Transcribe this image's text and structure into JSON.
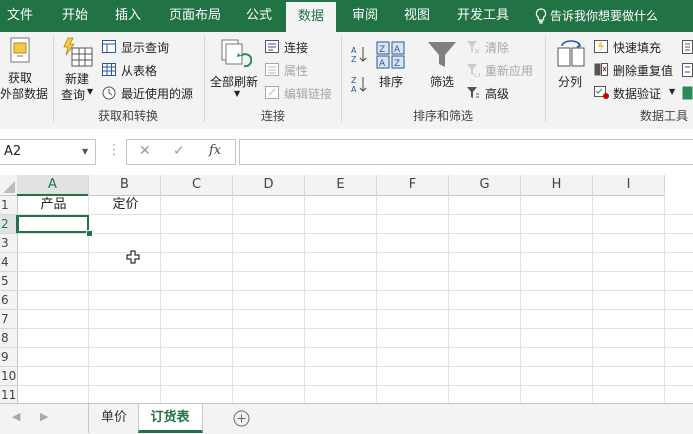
{
  "tabs": [
    "文件",
    "开始",
    "插入",
    "页面布局",
    "公式",
    "数据",
    "审阅",
    "视图",
    "开发工具"
  ],
  "tell_me": "告诉我你想要做什么",
  "ribbon": {
    "get_external": {
      "line1": "获取",
      "line2": "外部数据"
    },
    "new_query": {
      "line1": "新建",
      "line2": "查询"
    },
    "show_queries": "显示查询",
    "from_table": "从表格",
    "recent_sources": "最近使用的源",
    "group_get_transform": "获取和转换",
    "refresh_all": "全部刷新",
    "connections": "连接",
    "properties": "属性",
    "edit_links": "编辑链接",
    "group_connections": "连接",
    "sort": "排序",
    "filter": "筛选",
    "clear": "清除",
    "reapply": "重新应用",
    "advanced": "高级",
    "group_sort_filter": "排序和筛选",
    "text_to_columns": "分列",
    "flash_fill": "快速填充",
    "remove_duplicates": "删除重复值",
    "data_validation": "数据验证",
    "group_data_tools": "数据工具"
  },
  "formula_bar": {
    "name_box": "A2",
    "fx": "fx",
    "cancel": "✕",
    "enter": "✓",
    "value": ""
  },
  "columns": [
    "A",
    "B",
    "C",
    "D",
    "E",
    "F",
    "G",
    "H",
    "I"
  ],
  "rows": [
    "1",
    "2",
    "3",
    "4",
    "5",
    "6",
    "7",
    "8",
    "9",
    "10",
    "11"
  ],
  "cells": {
    "A1": "产品",
    "B1": "定价"
  },
  "sheets": [
    "单价",
    "订货表"
  ],
  "active_sheet": "订货表",
  "selected_cell": "A2"
}
